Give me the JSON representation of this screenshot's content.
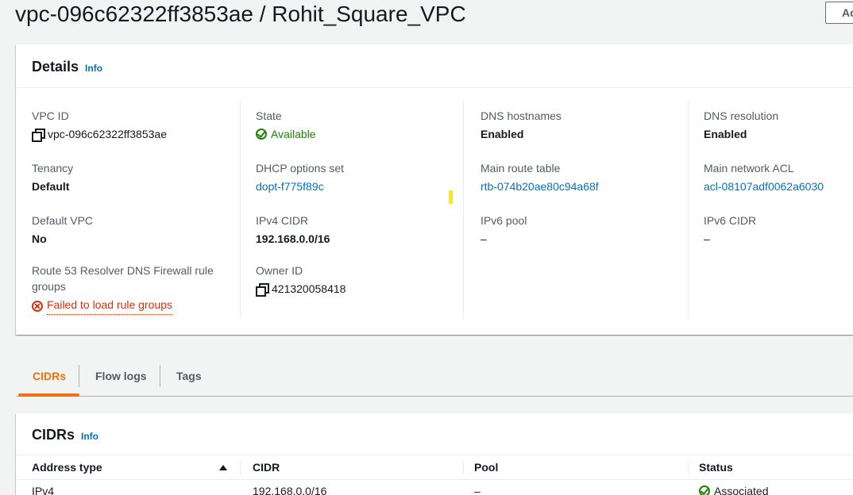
{
  "page": {
    "title": "vpc-096c62322ff3853ae / Rohit_Square_VPC",
    "actions_label": "Actions"
  },
  "details": {
    "title": "Details",
    "info": "Info",
    "fields": {
      "vpc_id": {
        "label": "VPC ID",
        "value": "vpc-096c62322ff3853ae"
      },
      "tenancy": {
        "label": "Tenancy",
        "value": "Default"
      },
      "default_vpc": {
        "label": "Default VPC",
        "value": "No"
      },
      "route53": {
        "label_line1": "Route 53 Resolver DNS Firewall rule",
        "label_line2": "groups",
        "value": "Failed to load rule groups"
      },
      "state": {
        "label": "State",
        "value": "Available"
      },
      "dhcp": {
        "label": "DHCP options set",
        "value": "dopt-f775f89c"
      },
      "ipv4_cidr": {
        "label": "IPv4 CIDR",
        "value": "192.168.0.0/16"
      },
      "owner_id": {
        "label": "Owner ID",
        "value": "421320058418"
      },
      "dns_hostnames": {
        "label": "DNS hostnames",
        "value": "Enabled"
      },
      "main_route_table": {
        "label": "Main route table",
        "value": "rtb-074b20ae80c94a68f"
      },
      "ipv6_pool": {
        "label": "IPv6 pool",
        "value": "–"
      },
      "dns_resolution": {
        "label": "DNS resolution",
        "value": "Enabled"
      },
      "main_acl": {
        "label": "Main network ACL",
        "value": "acl-08107adf0062a6030"
      },
      "ipv6_cidr": {
        "label": "IPv6 CIDR",
        "value": "–"
      }
    }
  },
  "tabs": [
    {
      "label": "CIDRs",
      "active": true
    },
    {
      "label": "Flow logs",
      "active": false
    },
    {
      "label": "Tags",
      "active": false
    }
  ],
  "cidrs": {
    "title": "CIDRs",
    "info": "Info",
    "columns": [
      "Address type",
      "CIDR",
      "Pool",
      "Status"
    ],
    "rows": [
      {
        "address_type": "IPv4",
        "cidr": "192.168.0.0/16",
        "pool": "–",
        "status": "Associated"
      }
    ]
  },
  "colors": {
    "link": "#0073bb",
    "success": "#1d8102",
    "error": "#d13212",
    "tab_active": "#ec7211"
  }
}
